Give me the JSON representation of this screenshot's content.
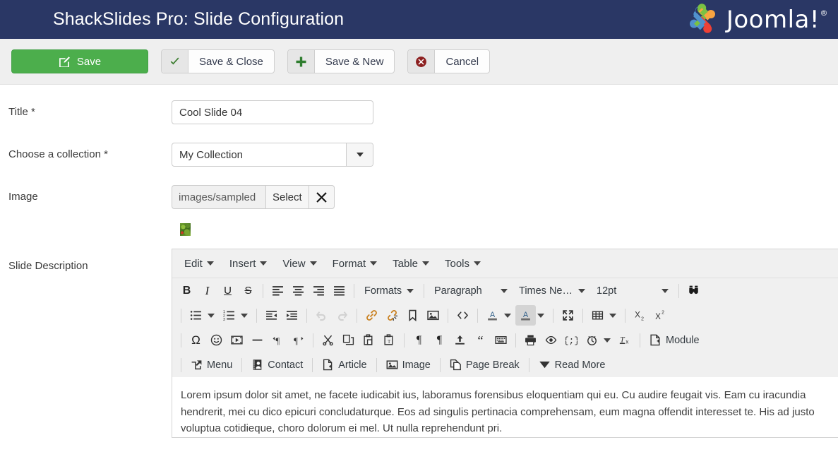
{
  "header": {
    "title": "ShackSlides Pro: Slide Configuration",
    "brand_word": "Joomla!",
    "brand_reg": "®",
    "bg_color": "#2a3765"
  },
  "toolbar": {
    "save_label": "Save",
    "save_close_label": "Save & Close",
    "save_new_label": "Save & New",
    "cancel_label": "Cancel",
    "save_bg": "#4cae4c"
  },
  "form": {
    "title_label": "Title *",
    "title_value": "Cool Slide 04",
    "collection_label": "Choose a collection *",
    "collection_value": "My Collection",
    "image_label": "Image",
    "image_path": "images/sampled",
    "image_select_label": "Select",
    "image_clear_label": "✖",
    "description_label": "Slide Description"
  },
  "editor": {
    "menu": [
      {
        "label": "Edit"
      },
      {
        "label": "Insert"
      },
      {
        "label": "View"
      },
      {
        "label": "Format"
      },
      {
        "label": "Table"
      },
      {
        "label": "Tools"
      }
    ],
    "row1": {
      "bold": "B",
      "italic": "I",
      "underline": "U",
      "strike": "S",
      "formats": "Formats",
      "paragraph": "Paragraph",
      "fontname": "Times Ne…",
      "fontsize": "12pt"
    },
    "row4_module": "Module",
    "row5": [
      {
        "label": "Menu",
        "icon": "menu-share-icon"
      },
      {
        "label": "Contact",
        "icon": "contact-card-icon"
      },
      {
        "label": "Article",
        "icon": "article-page-icon"
      },
      {
        "label": "Image",
        "icon": "image-picture-icon"
      },
      {
        "label": "Page Break",
        "icon": "page-break-icon"
      },
      {
        "label": "Read More",
        "icon": "read-more-chevron-icon"
      }
    ],
    "content": "Lorem ipsum dolor sit amet, ne facete iudicabit ius, laboramus forensibus eloquentiam qui eu. Cu audire feugait vis. Eam cu iracundia hendrerit, mei cu dico epicuri concludaturque. Eos ad singulis pertinacia comprehensam, eum magna offendit interesset te. His ad justo voluptua cotidieque, choro dolorum ei mel. Ut nulla reprehendunt pri."
  }
}
